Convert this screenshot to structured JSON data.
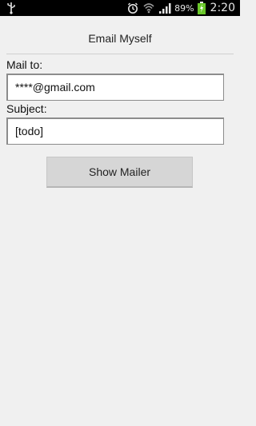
{
  "status_bar": {
    "battery_percent": "89%",
    "time": "2:20",
    "icons": [
      "usb-icon",
      "alarm-icon",
      "wifi-icon",
      "signal-icon",
      "battery-charging-icon"
    ]
  },
  "screen": {
    "title": "Email Myself"
  },
  "form": {
    "mail_to_label": "Mail to:",
    "mail_to_value": "****@gmail.com",
    "subject_label": "Subject:",
    "subject_value": "[todo]",
    "show_mailer_label": "Show Mailer"
  },
  "colors": {
    "status_bar_bg": "#000000",
    "screen_bg": "#f0f0f0",
    "battery_fill": "#6ac72a"
  }
}
